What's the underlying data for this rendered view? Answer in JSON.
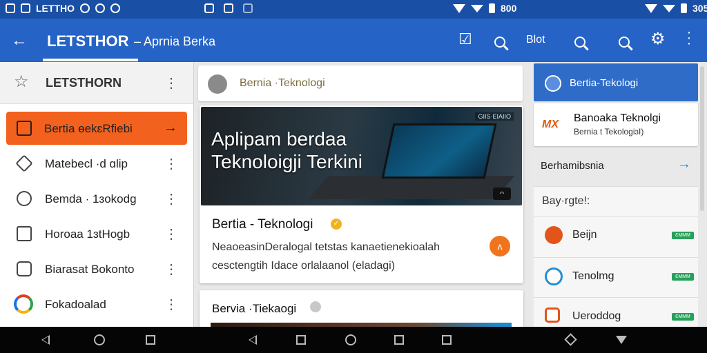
{
  "status_bar": {
    "left_text": "LETTHO",
    "right_time_1": "800",
    "right_time_2": "305"
  },
  "app_bar": {
    "title": "LETSTHOR",
    "subtitle": "– Aprnia Berka",
    "action_text": "Blot",
    "colors": {
      "bar": "#2563c6",
      "status": "#1a4fa6"
    }
  },
  "drawer": {
    "header_name": "LETSTHORN",
    "items": [
      {
        "label": "Bertia ɵekɛRfiebi",
        "icon": "inbox-icon",
        "active": true
      },
      {
        "label": "Matebecl ·d ɑlip",
        "icon": "diamond-icon"
      },
      {
        "label": "Bemda · 1ɜokodg",
        "icon": "clock-icon"
      },
      {
        "label": "Horoaa   1ɜtHogb",
        "icon": "notification-icon"
      },
      {
        "label": "Biarasat Bokonto",
        "icon": "share-icon"
      },
      {
        "label": "Fokadoalad",
        "icon": "chrome-icon"
      }
    ]
  },
  "center": {
    "header_text": "Bernia ·Teknologi",
    "hero": {
      "title_line1": "Aplipam berdaa",
      "title_line2": "Teknoloigji Terkini",
      "badge": "GIIS·ЕIAIIO",
      "corner_label": "ᴖ"
    },
    "article": {
      "title": "Bertia - Teknologi",
      "body": "NeaoeasinDeralogal tetstas kanaetienekioalah cesctengtih Idace orlalaanol (eladagi)",
      "fab_label": "ᴧ"
    },
    "article2_title": "Bervia ·Tiekaogi"
  },
  "right": {
    "header": "Bertia-Tekologi",
    "card": {
      "logo": "MX",
      "title": "Banoaka  Teknolgi",
      "subtitle": "Bernia t TekologiɜI)"
    },
    "link": "Berhamibsnia",
    "section_title": "Bay·rgte!:",
    "rows": [
      {
        "label": "Beijn",
        "icon": "orange-app-icon",
        "color": "#e3541a",
        "pill": "ƐMMM"
      },
      {
        "label": "Tenolmg",
        "icon": "swirl-icon",
        "color": "#1f8fd4",
        "pill": "ƐMMM"
      },
      {
        "label": "Ueroddog",
        "icon": "orange-square-icon",
        "color": "#e3541a",
        "pill": "ƐMMM"
      }
    ]
  }
}
